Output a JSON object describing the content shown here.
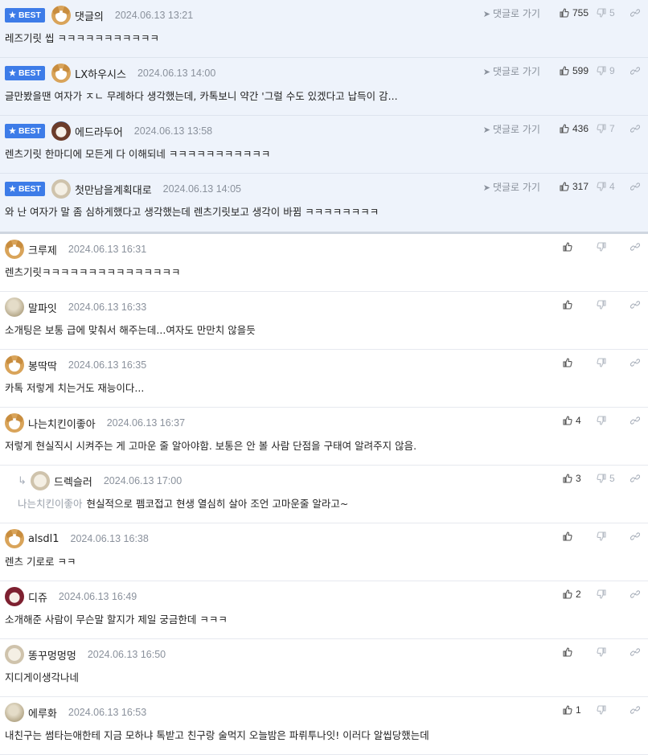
{
  "labels": {
    "best": "BEST",
    "reply": "댓글로 가기"
  },
  "comments": [
    {
      "best": true,
      "nick": "댓글의",
      "date": "2024.06.13 13:21",
      "text": "레즈기릿 씹 ㅋㅋㅋㅋㅋㅋㅋㅋㅋㅋㅋ",
      "up": "755",
      "down": "5",
      "avatar": "dog-icon"
    },
    {
      "best": true,
      "nick": "LX하우시스",
      "date": "2024.06.13 14:00",
      "text": "글만봤을땐 여자가 ㅈㄴ 무례하다 생각했는데, 카톡보니 약간 '그럴 수도 있겠다고 납득이 감...",
      "up": "599",
      "down": "9",
      "avatar": "dog-icon"
    },
    {
      "best": true,
      "nick": "에드라두어",
      "date": "2024.06.13 13:58",
      "text": "렌츠기릿 한마디에 모든게 다 이해되네 ㅋㅋㅋㅋㅋㅋㅋㅋㅋㅋㅋ",
      "up": "436",
      "down": "7",
      "avatar": "bear-icon"
    },
    {
      "best": true,
      "nick": "첫만남을계획대로",
      "date": "2024.06.13 14:05",
      "text": "와 난 여자가 말 좀 심하게했다고 생각했는데 렌츠기릿보고 생각이 바뀜 ㅋㅋㅋㅋㅋㅋㅋㅋ",
      "up": "317",
      "down": "4",
      "avatar": "puppy-icon"
    },
    {
      "best": false,
      "nick": "크루제",
      "date": "2024.06.13 16:31",
      "text": "렌츠기릿ㅋㅋㅋㅋㅋㅋㅋㅋㅋㅋㅋㅋㅋㅋㅋ",
      "up": "",
      "down": "",
      "avatar": "dog-icon"
    },
    {
      "best": false,
      "nick": "말파잇",
      "date": "2024.06.13 16:33",
      "text": "소개팅은 보통 급에 맞춰서 해주는데...여자도 만만치 않을듯",
      "up": "",
      "down": "",
      "avatar": "round-icon"
    },
    {
      "best": false,
      "nick": "봉딱딱",
      "date": "2024.06.13 16:35",
      "text": "카톡 저렇게 치는거도 재능이다...",
      "up": "",
      "down": "",
      "avatar": "dog-icon"
    },
    {
      "best": false,
      "nick": "나는치킨이좋아",
      "date": "2024.06.13 16:37",
      "text": "저렇게 현실직시 시켜주는 게 고마운 줄 알아야함. 보통은 안 볼 사람 단점을 구태여 알려주지 않음.",
      "up": "4",
      "down": "",
      "avatar": "dog-icon"
    },
    {
      "best": false,
      "reply": true,
      "mention": "나는치킨이좋아",
      "nick": "드렉슬러",
      "date": "2024.06.13 17:00",
      "text": "현실적으로 펨코접고 현생 열심히 살아 조언 고마운줄 알라고~",
      "up": "3",
      "down": "5",
      "avatar": "puppy-icon"
    },
    {
      "best": false,
      "nick": "alsdl1",
      "date": "2024.06.13 16:38",
      "text": "렌츠 기로로 ㅋㅋ",
      "up": "",
      "down": "",
      "avatar": "dog-icon"
    },
    {
      "best": false,
      "nick": "디쥬",
      "date": "2024.06.13 16:49",
      "text": "소개해준 사람이 무슨말 할지가 제일 궁금한데 ㅋㅋㅋ",
      "up": "2",
      "down": "",
      "avatar": "red-icon"
    },
    {
      "best": false,
      "nick": "똥꾸멍멍멍",
      "date": "2024.06.13 16:50",
      "text": "지디게이생각나네",
      "up": "",
      "down": "",
      "avatar": "puppy-icon"
    },
    {
      "best": false,
      "nick": "에루화",
      "date": "2024.06.13 16:53",
      "text": "내친구는 썸타는애한테 지금 모하냐 톡받고 친구랑 술먹지 오늘밤은 파뤼투나잇! 이러다 알씹당했는데",
      "up": "1",
      "down": "",
      "avatar": "round-icon"
    }
  ]
}
